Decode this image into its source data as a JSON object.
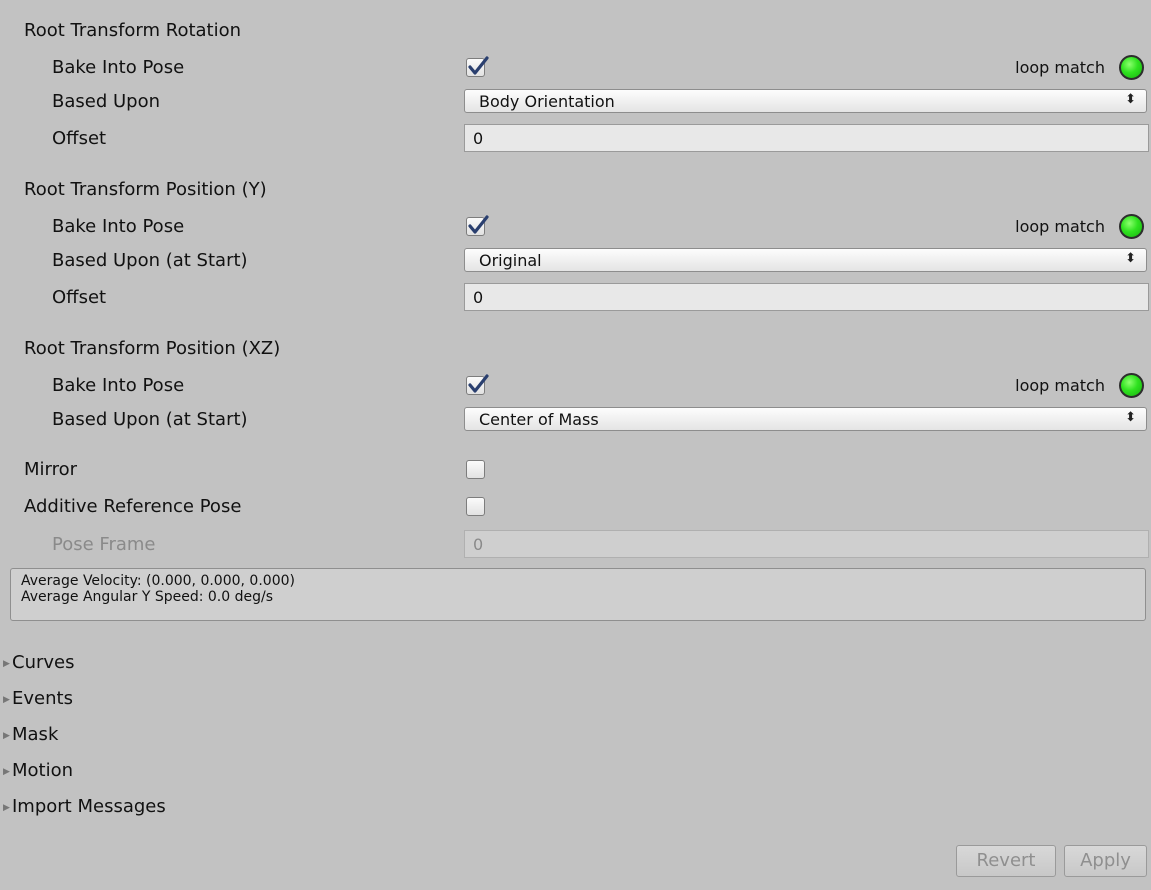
{
  "rotation": {
    "title": "Root Transform Rotation",
    "bake_label": "Bake Into Pose",
    "bake_checked": true,
    "loop_label": "loop match",
    "based_label": "Based Upon",
    "based_value": "Body Orientation",
    "offset_label": "Offset",
    "offset_value": "0"
  },
  "position_y": {
    "title": "Root Transform Position (Y)",
    "bake_label": "Bake Into Pose",
    "bake_checked": true,
    "loop_label": "loop match",
    "based_label": "Based Upon (at Start)",
    "based_value": "Original",
    "offset_label": "Offset",
    "offset_value": "0"
  },
  "position_xz": {
    "title": "Root Transform Position (XZ)",
    "bake_label": "Bake Into Pose",
    "bake_checked": true,
    "loop_label": "loop match",
    "based_label": "Based Upon (at Start)",
    "based_value": "Center of Mass"
  },
  "mirror": {
    "label": "Mirror",
    "checked": false
  },
  "additive": {
    "label": "Additive Reference Pose",
    "checked": false
  },
  "pose_frame": {
    "label": "Pose Frame",
    "value": "0"
  },
  "info": {
    "velocity": "Average Velocity: (0.000, 0.000, 0.000)",
    "angular": "Average Angular Y Speed: 0.0 deg/s"
  },
  "foldouts": [
    "Curves",
    "Events",
    "Mask",
    "Motion",
    "Import Messages"
  ],
  "buttons": {
    "revert": "Revert",
    "apply": "Apply"
  },
  "colors": {
    "background": "#c2c2c2",
    "loop_match_ok": "#2fe21f",
    "checkmark": "#2a3f6f"
  }
}
